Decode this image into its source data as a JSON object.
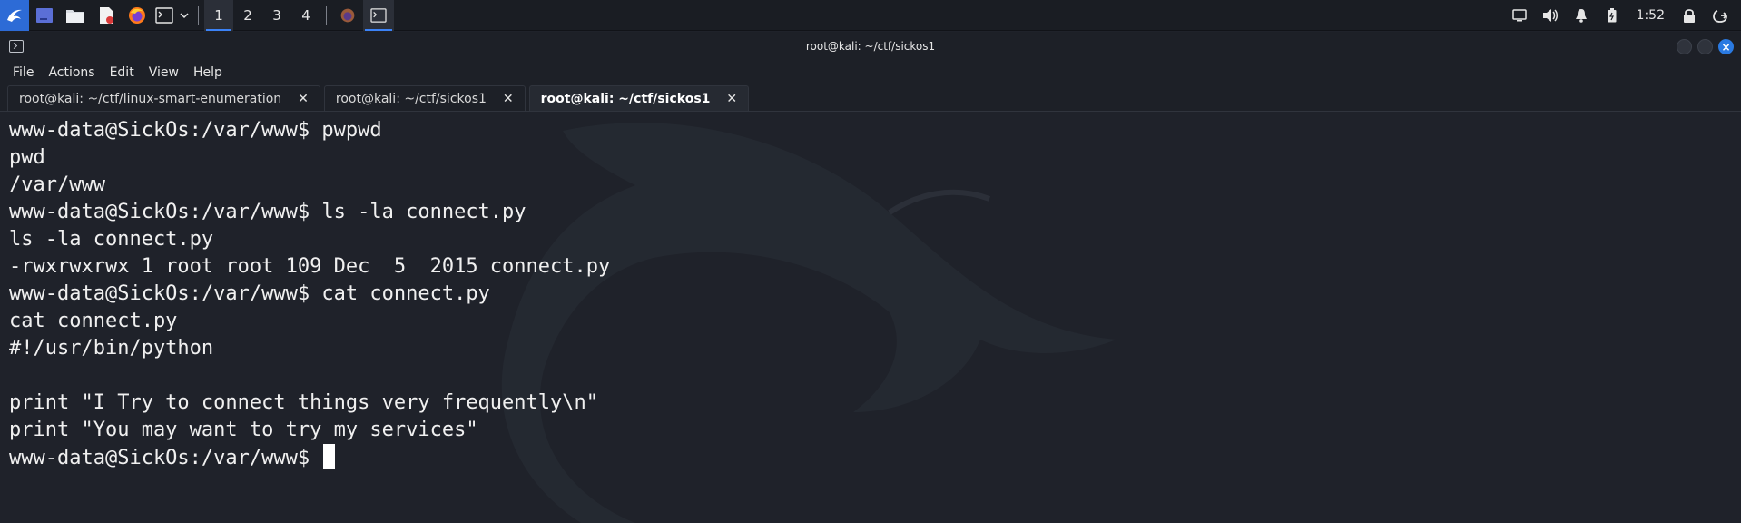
{
  "taskbar": {
    "workspaces": [
      "1",
      "2",
      "3",
      "4"
    ],
    "active_workspace": "1",
    "clock": "1:52",
    "icons": [
      "kali-menu-icon",
      "desktop-icon",
      "file-manager-icon",
      "text-editor-icon",
      "firefox-icon",
      "terminal-icon",
      "chevron-down-icon"
    ],
    "tray_icons": [
      "display-icon",
      "volume-icon",
      "bell-icon",
      "battery-icon",
      "lock-icon",
      "power-icon"
    ]
  },
  "window": {
    "title": "root@kali: ~/ctf/sickos1",
    "menu": [
      "File",
      "Actions",
      "Edit",
      "View",
      "Help"
    ],
    "tabs": [
      {
        "label": "root@kali: ~/ctf/linux-smart-enumeration",
        "active": false
      },
      {
        "label": "root@kali: ~/ctf/sickos1",
        "active": false
      },
      {
        "label": "root@kali: ~/ctf/sickos1",
        "active": true
      }
    ],
    "tab_close_glyph": "✕"
  },
  "terminal": {
    "lines": [
      "www-data@SickOs:/var/www$ pwpwd",
      "pwd",
      "/var/www",
      "www-data@SickOs:/var/www$ ls -la connect.py",
      "ls -la connect.py",
      "-rwxrwxrwx 1 root root 109 Dec  5  2015 connect.py",
      "www-data@SickOs:/var/www$ cat connect.py",
      "cat connect.py",
      "#!/usr/bin/python",
      "",
      "print \"I Try to connect things very frequently\\n\"",
      "print \"You may want to try my services\"",
      "www-data@SickOs:/var/www$ "
    ]
  },
  "colors": {
    "accent": "#2a7ae2",
    "terminal_bg": "#1f222a",
    "text": "#f0f0f0"
  }
}
